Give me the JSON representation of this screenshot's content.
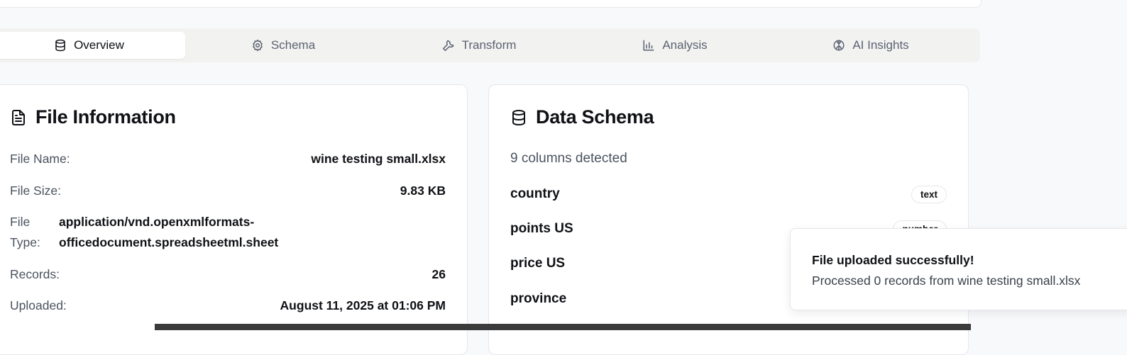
{
  "tabs": [
    {
      "label": "Overview",
      "icon": "database-icon",
      "active": true
    },
    {
      "label": "Schema",
      "icon": "gear-icon",
      "active": false
    },
    {
      "label": "Transform",
      "icon": "wrench-icon",
      "active": false
    },
    {
      "label": "Analysis",
      "icon": "bar-chart-icon",
      "active": false
    },
    {
      "label": "AI Insights",
      "icon": "brain-icon",
      "active": false
    }
  ],
  "file_info": {
    "title": "File Information",
    "name_label": "File Name:",
    "name_value": "wine testing small.xlsx",
    "size_label": "File Size:",
    "size_value": "9.83 KB",
    "type_label": "File Type:",
    "type_value": "application/vnd.openxmlformats-officedocument.spreadsheetml.sheet",
    "records_label": "Records:",
    "records_value": "26",
    "uploaded_label": "Uploaded:",
    "uploaded_value": "August 11, 2025 at 01:06 PM"
  },
  "schema": {
    "title": "Data Schema",
    "subtitle": "9 columns detected",
    "columns": [
      {
        "name": "country",
        "type": "text"
      },
      {
        "name": "points US",
        "type": "number"
      },
      {
        "name": "price US",
        "type": ""
      },
      {
        "name": "province",
        "type": ""
      }
    ]
  },
  "toast": {
    "title": "File uploaded successfully!",
    "description": "Processed 0 records from wine testing small.xlsx"
  },
  "colors": {
    "background": "#f8f9fb",
    "card": "#ffffff",
    "tab_bar": "#f2f2f1",
    "border": "#e5e7eb"
  }
}
